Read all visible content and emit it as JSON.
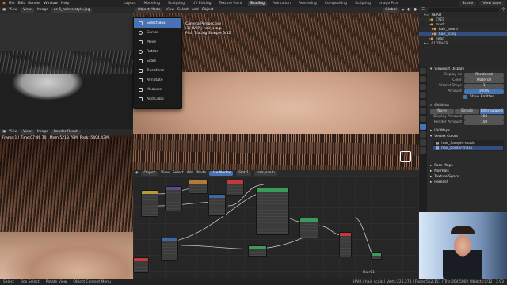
{
  "menubar": {
    "menus": [
      "File",
      "Edit",
      "Render",
      "Window",
      "Help"
    ],
    "workspaces": [
      "Layout",
      "Modeling",
      "Sculpting",
      "UV Editing",
      "Texture Paint",
      "Shading",
      "Animation",
      "Rendering",
      "Compositing",
      "Scripting",
      "Image Proc"
    ],
    "active_workspace": "Shading",
    "scene": "Scene",
    "view_layer": "View Layer"
  },
  "image_top": {
    "header": [
      "View",
      "View",
      "Image",
      "cc 6_hairss-style.jpg"
    ]
  },
  "image_bottom": {
    "header": [
      "View",
      "View",
      "Image",
      "Render Result"
    ],
    "stats": "Frame:1 | Time:07:46.70 | Mem:5213.78M, Peak: 5404.43M"
  },
  "viewport": {
    "header": [
      "Object Mode",
      "View",
      "Select",
      "Add",
      "Object"
    ],
    "orientation": "Global",
    "overlay_lines": [
      "Camera Perspective",
      "(1) HAIR | hair_scalp",
      "Path Tracing Sample 6/32"
    ]
  },
  "add_menu": {
    "items": [
      "Select Box",
      "Cursor",
      "Move",
      "Rotate",
      "Scale",
      "Transform",
      "Annotate",
      "Measure",
      "Add Cube"
    ],
    "selected_index": 0
  },
  "node_editor": {
    "header": [
      "Object",
      "View",
      "Select",
      "Add",
      "Node",
      "Use Nodes",
      "Slot 1",
      "hair_scalp"
    ],
    "footer": "Hair01"
  },
  "outliner": {
    "rows": [
      {
        "label": "HEAD",
        "selected": false
      },
      {
        "label": "EYES",
        "selected": false
      },
      {
        "label": "mask",
        "selected": false
      },
      {
        "label": "hair_beard",
        "selected": false
      },
      {
        "label": "hair_scalp",
        "selected": true
      },
      {
        "label": "head",
        "selected": false
      },
      {
        "label": "CLOTHES",
        "selected": false
      }
    ]
  },
  "properties": {
    "viewport_display": "Viewport Display",
    "display_as_label": "Display As",
    "display_as_value": "Rendered",
    "color_label": "Color",
    "color_value": "Material",
    "strand_steps_label": "Strand Steps",
    "strand_steps_value": "3",
    "amount_label": "Amount",
    "amount_value": "100%",
    "show_emitter": "Show Emitter",
    "children": "Children",
    "children_modes": [
      "None",
      "Simple",
      "Interpolated"
    ],
    "children_active": "Interpolated",
    "display_amount_label": "Display Amount",
    "display_amount_value": "150",
    "render_amount_label": "Render Amount",
    "render_amount_value": "150",
    "uv_maps": "UV Maps",
    "vertex_colors": "Vertex Colors",
    "vc_items": [
      "hair_Sample-mask",
      "hair_border-mask"
    ],
    "face_maps": "Face Maps",
    "normals": "Normals",
    "texture_space": "Texture Space",
    "remesh": "Remesh"
  },
  "status": {
    "items": [
      "Select",
      "Box Select",
      "Rotate View",
      "Object Context Menu"
    ],
    "right": "HAIR | hair_scalp | Verts:226,274 | Faces:552,151 | Tris:204,500 | Objects:0/12 | 2.93"
  },
  "colors": {
    "accent": "#4772b3",
    "panel": "#2b2b2b",
    "header": "#2a2a2a"
  }
}
